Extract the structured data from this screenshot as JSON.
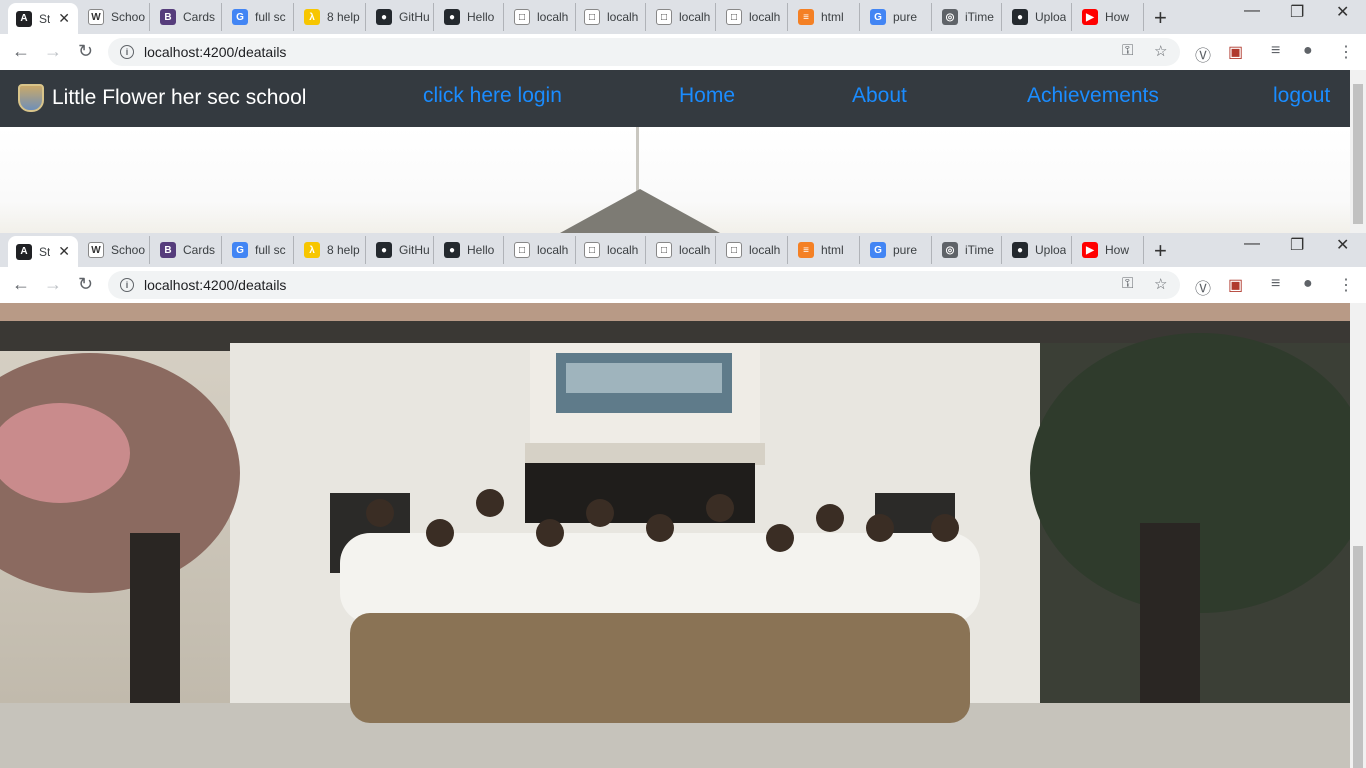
{
  "browser": {
    "tabs": [
      {
        "title": "St",
        "fav_color": "#202124",
        "fav_glyph": "A"
      },
      {
        "title": "Schoo",
        "fav_color": "#ffffff",
        "fav_glyph": "W"
      },
      {
        "title": "Cards",
        "fav_color": "#563d7c",
        "fav_glyph": "B"
      },
      {
        "title": "full sc",
        "fav_color": "#4285f4",
        "fav_glyph": "G"
      },
      {
        "title": "8 help",
        "fav_color": "#f7c600",
        "fav_glyph": "λ"
      },
      {
        "title": "GitHu",
        "fav_color": "#24292e",
        "fav_glyph": "●"
      },
      {
        "title": "Hello",
        "fav_color": "#24292e",
        "fav_glyph": "●"
      },
      {
        "title": "localh",
        "fav_color": "#ffffff",
        "fav_glyph": "□"
      },
      {
        "title": "localh",
        "fav_color": "#ffffff",
        "fav_glyph": "□"
      },
      {
        "title": "localh",
        "fav_color": "#ffffff",
        "fav_glyph": "□"
      },
      {
        "title": "localh",
        "fav_color": "#ffffff",
        "fav_glyph": "□"
      },
      {
        "title": "html",
        "fav_color": "#f48024",
        "fav_glyph": "≡"
      },
      {
        "title": "pure",
        "fav_color": "#4285f4",
        "fav_glyph": "G"
      },
      {
        "title": "iTime",
        "fav_color": "#5f6368",
        "fav_glyph": "◎"
      },
      {
        "title": "Uploa",
        "fav_color": "#24292e",
        "fav_glyph": "●"
      },
      {
        "title": "How",
        "fav_color": "#ff0000",
        "fav_glyph": "▶"
      }
    ],
    "url": "localhost:4200/deatails"
  },
  "navbar": {
    "brand": "Little Flower her sec school",
    "links": {
      "login": "click here login",
      "home": "Home",
      "about": "About",
      "achievements": "Achievements",
      "logout": "logout"
    }
  }
}
